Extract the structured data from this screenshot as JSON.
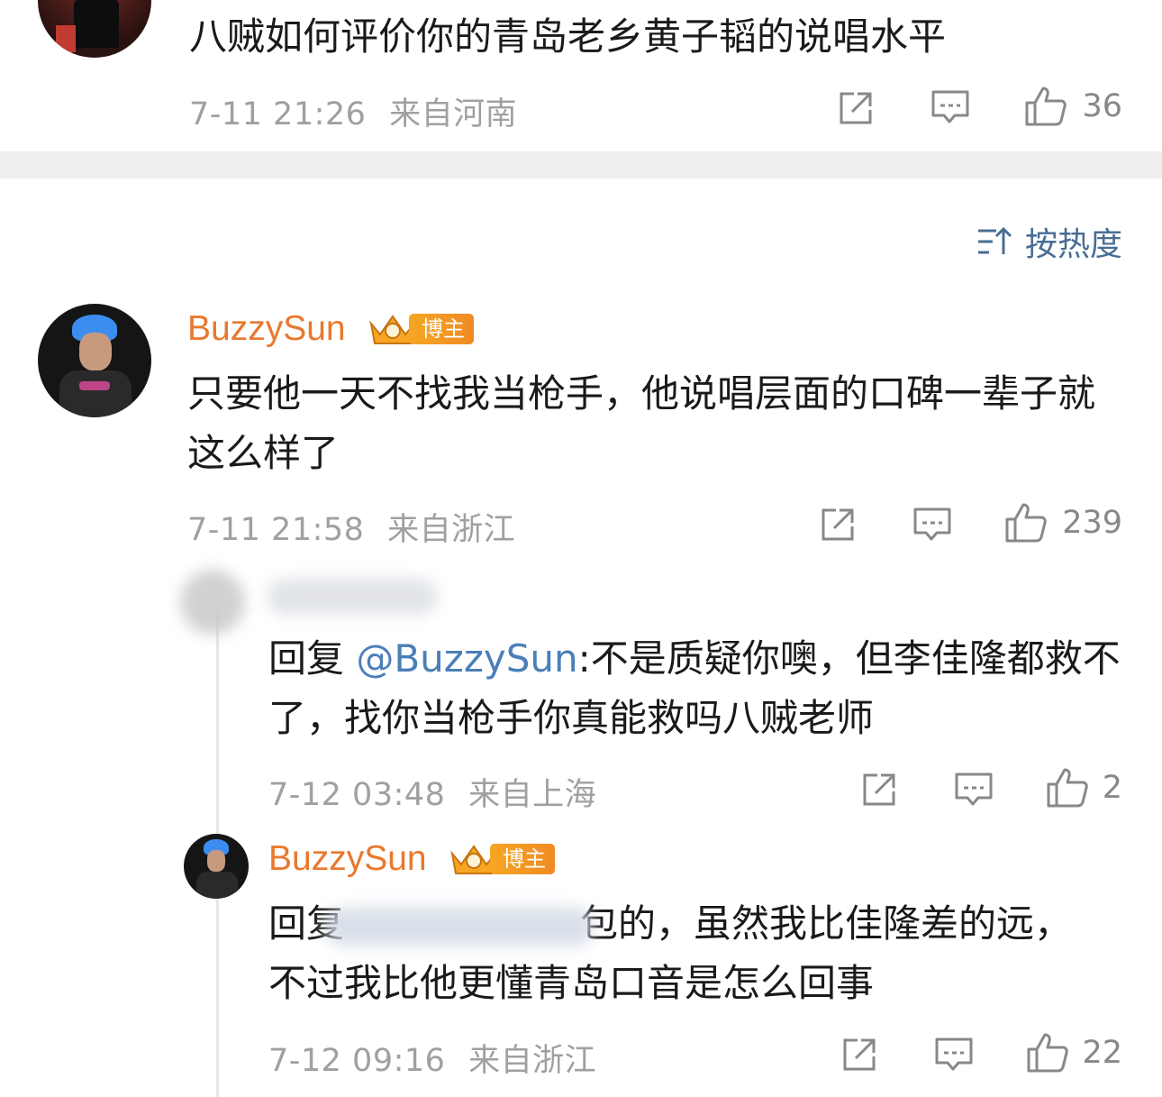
{
  "top_comment": {
    "text": "八贼如何评价你的青岛老乡黄子韬的说唱水平",
    "time": "7-11 21:26",
    "location": "来自河南",
    "likes": "36"
  },
  "sort": {
    "label": "按热度"
  },
  "comment1": {
    "name": "BuzzySun",
    "badge": "博主",
    "text": "只要他一天不找我当枪手，他说唱层面的口碑一辈子就这么样了",
    "time": "7-11 21:58",
    "location": "来自浙江",
    "likes": "239"
  },
  "reply1": {
    "prefix": "回复 ",
    "mention": "@BuzzySun",
    "text": ":不是质疑你噢，但李佳隆都救不了，找你当枪手你真能救吗八贼老师",
    "time": "7-12 03:48",
    "location": "来自上海",
    "likes": "2"
  },
  "reply2": {
    "name": "BuzzySun",
    "badge": "博主",
    "prefix": "回复",
    "text_line1": "包的，虽然我比佳隆差的远，",
    "text_line2": "不过我比他更懂青岛口音是怎么回事",
    "time": "7-12 09:16",
    "location": "来自浙江",
    "likes": "22"
  },
  "colors": {
    "name": "#e8792f",
    "mention": "#4a7fb8",
    "meta": "#a0a0a0",
    "divider": "#eeeeee",
    "sort": "#4a6d94"
  },
  "icons": [
    "share-icon",
    "comment-icon",
    "like-icon",
    "sort-icon",
    "crown-icon"
  ]
}
